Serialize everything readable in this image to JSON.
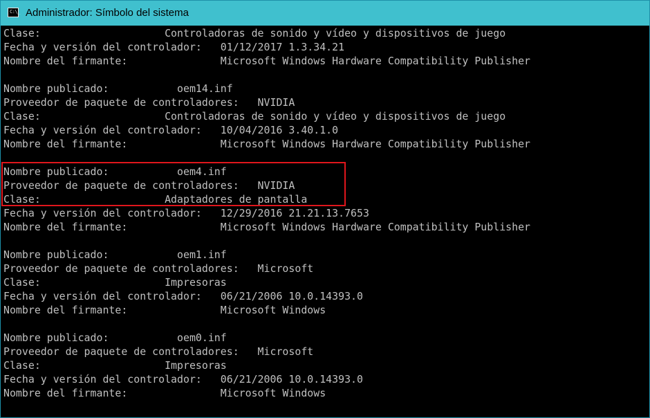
{
  "window": {
    "title": "Administrador: Símbolo del sistema",
    "icon": "console-icon",
    "icon_glyph": "C:\\_"
  },
  "colors": {
    "titlebar_bg": "#40C0CE",
    "console_bg": "#000000",
    "console_text": "#C0C0C0",
    "highlight_border": "#E0161C"
  },
  "console": {
    "lines": [
      "Clase:                    Controladoras de sonido y vídeo y dispositivos de juego",
      "Fecha y versión del controlador:   01/12/2017 1.3.34.21",
      "Nombre del firmante:               Microsoft Windows Hardware Compatibility Publisher",
      "",
      "Nombre publicado:           oem14.inf",
      "Proveedor de paquete de controladores:   NVIDIA",
      "Clase:                    Controladoras de sonido y vídeo y dispositivos de juego",
      "Fecha y versión del controlador:   10/04/2016 3.40.1.0",
      "Nombre del firmante:               Microsoft Windows Hardware Compatibility Publisher",
      "",
      "Nombre publicado:           oem4.inf",
      "Proveedor de paquete de controladores:   NVIDIA",
      "Clase:                    Adaptadores de pantalla",
      "Fecha y versión del controlador:   12/29/2016 21.21.13.7653",
      "Nombre del firmante:               Microsoft Windows Hardware Compatibility Publisher",
      "",
      "Nombre publicado:           oem1.inf",
      "Proveedor de paquete de controladores:   Microsoft",
      "Clase:                    Impresoras",
      "Fecha y versión del controlador:   06/21/2006 10.0.14393.0",
      "Nombre del firmante:               Microsoft Windows",
      "",
      "Nombre publicado:           oem0.inf",
      "Proveedor de paquete de controladores:   Microsoft",
      "Clase:                    Impresoras",
      "Fecha y versión del controlador:   06/21/2006 10.0.14393.0",
      "Nombre del firmante:               Microsoft Windows"
    ]
  }
}
